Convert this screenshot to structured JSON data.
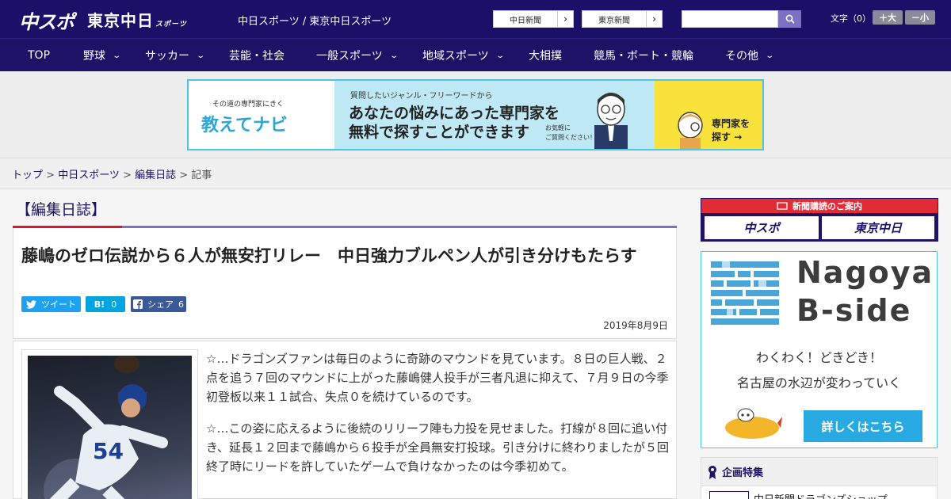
{
  "header": {
    "logo_chuspo": "中スポ",
    "logo_tokyo": "東京中日",
    "logo_tokyo_suffix": "スポーツ",
    "site_links": "中日スポーツ / 東京中日スポーツ",
    "paper_chunichi": "中日新聞",
    "paper_tokyo": "東京新聞",
    "search_placeholder": "",
    "fontsize_label": "文字（0）",
    "font_larger": "＋大",
    "font_smaller": "－小"
  },
  "nav": {
    "items": [
      {
        "label": "TOP"
      },
      {
        "label": "野球"
      },
      {
        "label": "サッカー"
      },
      {
        "label": "芸能・社会"
      },
      {
        "label": "一般スポーツ"
      },
      {
        "label": "地域スポーツ"
      },
      {
        "label": "大相撲"
      },
      {
        "label": "競馬・ボート・競輪"
      },
      {
        "label": "その他"
      }
    ]
  },
  "ad": {
    "tagline": "その道の専門家にきく",
    "brand": "教えてナビ",
    "line1": "質問したいジャンル・フリーワードから",
    "line2": "あなたの悩みにあった専門家を",
    "line3": "無料で探すことができます",
    "note": "お気軽に\nご質問ください！",
    "cta": "専門家を\n探す →"
  },
  "breadcrumb": {
    "top": "トップ",
    "sep1": " > ",
    "chunichi_sports": "中日スポーツ",
    "sep2": " > ",
    "diary": "編集日誌",
    "sep3": " > ",
    "current": "記事"
  },
  "section": {
    "title": "【編集日誌】"
  },
  "article": {
    "headline": "藤嶋のゼロ伝説から６人が無安打リレー　中日強力ブルペン人が引き分けもたらす",
    "tweet_label": "ツイート",
    "hatena_label": "B!",
    "hatena_count": "0",
    "share_label": "シェア",
    "share_count": "6",
    "date": "2019年8月9日",
    "paragraph1": "☆…ドラゴンズファンは毎日のように奇跡のマウンドを見ています。８日の巨人戦、２点を追う７回のマウンドに上がった藤嶋健人投手が三者凡退に抑えて、７月９日の今季初登板以来１１試合、失点０を続けているのです。",
    "paragraph2": "☆…この姿に応えるように後続のリリーフ陣も力投を見せました。打線が８回に追い付き、延長１２回まで藤嶋から６投手が全員無安打投球。引き分けに終わりましたが５回終了時にリードを許していたゲームで負けなかったのは今季初めて。"
  },
  "sidebar": {
    "subscribe_header": "新聞購読のご案内",
    "subscribe_chuspo": "中スポ",
    "subscribe_tokyo": "東京中日",
    "bside_title1": "Nagoya",
    "bside_title2": "B-side",
    "bside_text1": "わくわく！どきどき！",
    "bside_text2": "名古屋の水辺が変わっていく",
    "bside_button": "詳しくはこちら",
    "feature_header": "企画特集",
    "feature_item": "中日新聞ドラゴンズショップ"
  },
  "colors": {
    "header_bg": "#1a1067",
    "nav_bg": "#1e1266",
    "accent_red": "#d9182e",
    "accent_purple": "#7b72c4",
    "twitter": "#1da1f2",
    "hatena": "#00a4de",
    "facebook": "#3b5998",
    "bside_button": "#28a9e1"
  },
  "icons": {
    "search": "search-icon",
    "chevron": "chevron-down-icon",
    "twitter": "twitter-icon",
    "facebook": "facebook-icon"
  }
}
